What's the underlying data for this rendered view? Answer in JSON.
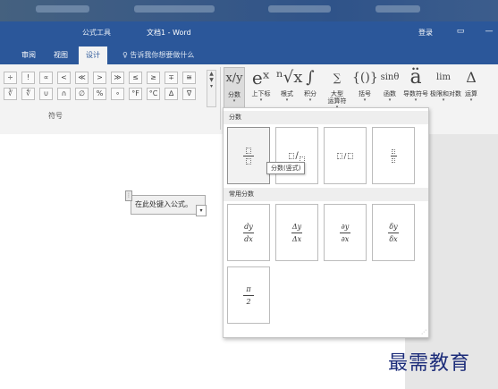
{
  "title_bar": {
    "context_tool": "公式工具",
    "document_title": "文档1 - Word",
    "login": "登录"
  },
  "tabs": {
    "review": "审阅",
    "view": "视图",
    "design": "设计",
    "tell_me": "告诉我你想要做什么"
  },
  "symbols": {
    "group_label": "符号",
    "row1": [
      "÷",
      "!",
      "∝",
      "<",
      "≪",
      ">",
      "≫",
      "≤",
      "≥",
      "∓",
      "≅"
    ],
    "row2": [
      "∛",
      "∜",
      "∪",
      "∩",
      "∅",
      "%",
      "∘",
      "°F",
      "°C",
      "∆",
      "∇"
    ]
  },
  "structures": [
    {
      "icon": "x/y",
      "label": "分数"
    },
    {
      "icon": "eˣ",
      "label": "上下标"
    },
    {
      "icon": "ⁿ√x",
      "label": "根式"
    },
    {
      "icon": "∫",
      "label": "积分"
    },
    {
      "icon": "∑",
      "label": "大型\n运算符"
    },
    {
      "icon": "{()}",
      "label": "括号"
    },
    {
      "icon": "sinθ",
      "label": "函数"
    },
    {
      "icon": "ä",
      "label": "导数符号"
    },
    {
      "icon": "lim",
      "label": "极限和对数"
    },
    {
      "icon": "Δ",
      "label": "运算"
    }
  ],
  "gallery": {
    "section_fraction": "分数",
    "section_common": "常用分数",
    "tooltip": "分数(竖式)",
    "common": [
      {
        "num": "dy",
        "den": "dx"
      },
      {
        "num": "Δy",
        "den": "Δx"
      },
      {
        "num": "∂y",
        "den": "∂x"
      },
      {
        "num": "δy",
        "den": "δx"
      },
      {
        "num": "π",
        "den": "2"
      }
    ]
  },
  "document": {
    "equation_placeholder": "在此处键入公式。"
  },
  "watermark": "最需教育"
}
